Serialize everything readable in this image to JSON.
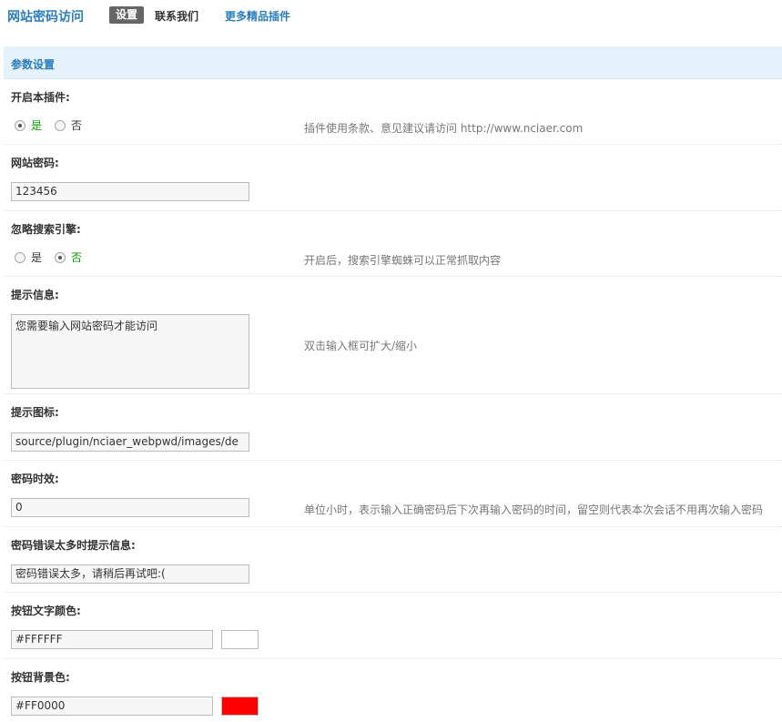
{
  "nav": {
    "title": "网站密码访问",
    "tab_settings": "设置",
    "tab_contact": "联系我们",
    "tab_more": "更多精品插件"
  },
  "section": {
    "title": "参数设置"
  },
  "settings": {
    "enable": {
      "label": "开启本插件:",
      "yes": "是",
      "no": "否",
      "selected": "yes",
      "tip": "插件使用条款、意见建议请访问 http://www.nciaer.com"
    },
    "password": {
      "label": "网站密码:",
      "value": "123456"
    },
    "ignore_search": {
      "label": "忽略搜索引擎:",
      "yes": "是",
      "no": "否",
      "selected": "no",
      "tip": "开启后，搜索引擎蜘蛛可以正常抓取内容"
    },
    "prompt": {
      "label": "提示信息:",
      "value": "您需要输入网站密码才能访问",
      "tip": "双击输入框可扩大/缩小"
    },
    "icon": {
      "label": "提示图标:",
      "value": "source/plugin/nciaer_webpwd/images/de"
    },
    "expire": {
      "label": "密码时效:",
      "value": "0",
      "tip": "单位小时，表示输入正确密码后下次再输入密码的时间，留空则代表本次会话不用再次输入密码"
    },
    "error_msg": {
      "label": "密码错误太多时提示信息:",
      "value": "密码错误太多，请稍后再试吧:("
    },
    "btn_text_color": {
      "label": "按钮文字颜色:",
      "value": "#FFFFFF",
      "swatch": "#FFFFFF"
    },
    "btn_bg_color": {
      "label": "按钮背景色:",
      "value": "#FF0000",
      "swatch": "#FF0000"
    }
  },
  "colors": {
    "brand_blue": "#2b7dbc",
    "header_bg": "#e6f2fb",
    "selected_green": "#0a9c00"
  }
}
